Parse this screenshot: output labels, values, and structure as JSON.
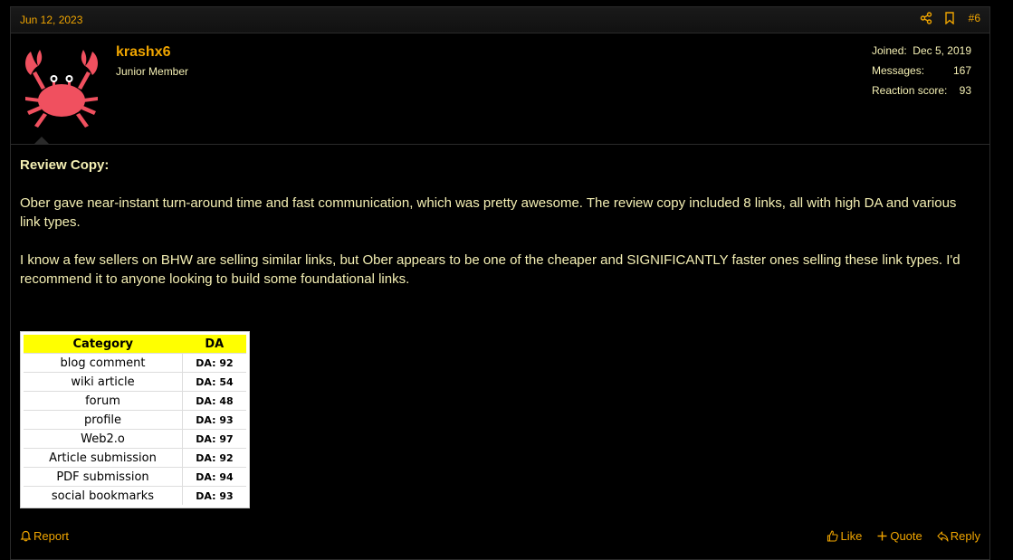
{
  "post": {
    "date": "Jun 12, 2023",
    "number": "#6",
    "colors": {
      "accent": "#f0a500",
      "text": "#f5f0b4",
      "background": "#000000"
    }
  },
  "user": {
    "name": "krashx6",
    "title": "Junior Member",
    "avatar_icon": "crab-icon",
    "stats": [
      {
        "label": "Joined:",
        "value": "Dec 5, 2019"
      },
      {
        "label": "Messages:",
        "value": "167"
      },
      {
        "label": "Reaction score:",
        "value": "93"
      }
    ]
  },
  "content": {
    "heading": "Review Copy:",
    "paragraph1": "Ober gave near-instant turn-around time and fast communication, which was pretty awesome. The review copy included 8 links, all with high DA and various link types.",
    "paragraph2": "I know a few sellers on BHW are selling similar links, but Ober appears to be one of the cheaper and SIGNIFICANTLY faster ones selling these link types. I'd recommend it to anyone looking to build some foundational links."
  },
  "table": {
    "headers": [
      "Category",
      "DA"
    ],
    "rows": [
      {
        "category": "blog comment",
        "da": "DA: 92"
      },
      {
        "category": "wiki article",
        "da": "DA: 54"
      },
      {
        "category": "forum",
        "da": "DA: 48"
      },
      {
        "category": "profile",
        "da": "DA: 93"
      },
      {
        "category": "Web2.o",
        "da": "DA: 97"
      },
      {
        "category": "Article submission",
        "da": "DA: 92"
      },
      {
        "category": "PDF submission",
        "da": "DA: 94"
      },
      {
        "category": "social bookmarks",
        "da": "DA: 93"
      }
    ]
  },
  "footer": {
    "report_label": "Report",
    "like_label": "Like",
    "quote_label": "Quote",
    "reply_label": "Reply"
  }
}
